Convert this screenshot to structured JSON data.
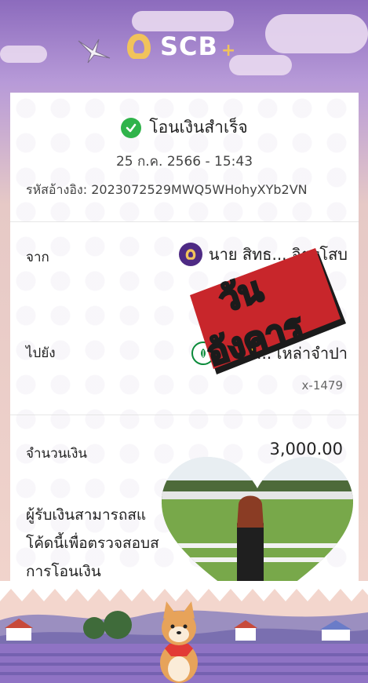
{
  "header": {
    "logo_text": "SCB",
    "logo_plus": "+"
  },
  "receipt": {
    "status": "โอนเงินสำเร็จ",
    "datetime": "25 ก.ค. 2566 - 15:43",
    "reference": "รหัสอ้างอิง: 2023072529MWQ5WHohyXYb2VN",
    "from_label": "จาก",
    "from_name": "นาย สิทธ... จิตรโสบ",
    "to_label": "ไปยัง",
    "to_name": "น.ส. ... เหล่าจำปา",
    "to_account": "x-1479",
    "amount_label": "จำนวนเงิน",
    "amount_value": "3,000.00",
    "note_line1": "ผู้รับเงินสามารถสแ",
    "note_line2": "โค้ดนี้เพื่อตรวจสอบส",
    "note_line3": "การโอนเงิน"
  },
  "sticker_text_line1": "วัน",
  "sticker_text_line2": "อังคาร",
  "colors": {
    "scb_purple": "#4e2a84",
    "success_green": "#2fb34a",
    "kbank_green": "#0a8a3a",
    "gold": "#f1c35b"
  }
}
